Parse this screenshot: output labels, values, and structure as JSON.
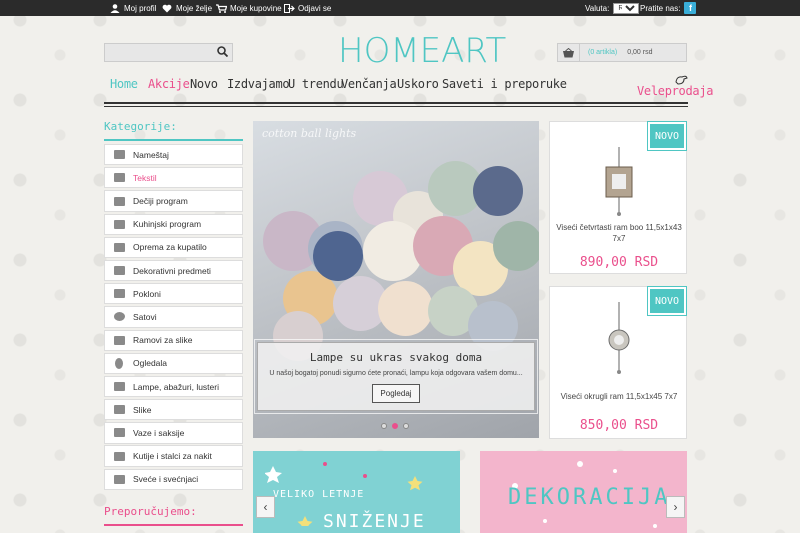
{
  "topbar": {
    "profile": "Moj profil",
    "wishes": "Moje želje",
    "purchases": "Moje kupovine",
    "logout": "Odjavi se",
    "currency_label": "Valuta:",
    "currency_value": "RSD",
    "follow_label": "Pratite nas:",
    "facebook": "f"
  },
  "search": {
    "placeholder": ""
  },
  "logo": {
    "text": "HOMEART"
  },
  "cart": {
    "count": "(0 artikla)",
    "total": "0,00 rsd"
  },
  "nav": {
    "items": [
      "Home",
      "Akcije",
      "Novo",
      "Izdvajamo",
      "U trendu",
      "Venčanja",
      "Uskoro",
      "Saveti i preporuke"
    ],
    "wholesale": "Veleprodaja"
  },
  "sidebar": {
    "title": "Kategorije:",
    "items": [
      "Nameštaj",
      "Tekstil",
      "Dečiji program",
      "Kuhinjski program",
      "Oprema za kupatilo",
      "Dekorativni predmeti",
      "Pokloni",
      "Satovi",
      "Ramovi za slike",
      "Ogledala",
      "Lampe, abažuri, lusteri",
      "Slike",
      "Vaze i saksije",
      "Kutije i stalci za nakit",
      "Sveće i svećnjaci"
    ],
    "recommend_title": "Preporučujemo:"
  },
  "slider": {
    "watermark": "cotton ball lights",
    "title": "Lampe su ukras svakog doma",
    "text": "U našoj bogatoj ponudi sigurno ćete pronaći, lampu koja odgovara vašem domu...",
    "button": "Pogledaj"
  },
  "products": [
    {
      "badge": "NOVO",
      "name": "Viseći četvrtasti ram boo 11,5x1x43 7x7",
      "price": "890,00 RSD"
    },
    {
      "badge": "NOVO",
      "name": "Viseći okrugli ram 11,5x1x45 7x7",
      "price": "850,00 RSD"
    }
  ],
  "banners": {
    "left_line1": "VELIKO LETNJE",
    "left_line2": "SNIŽENJE",
    "right": "DEKORACIJA",
    "prev": "‹",
    "next": "›"
  },
  "colors": {
    "accent": "#4fc6c3",
    "pink": "#ea4f8c",
    "topbar": "#2b2b2b"
  }
}
